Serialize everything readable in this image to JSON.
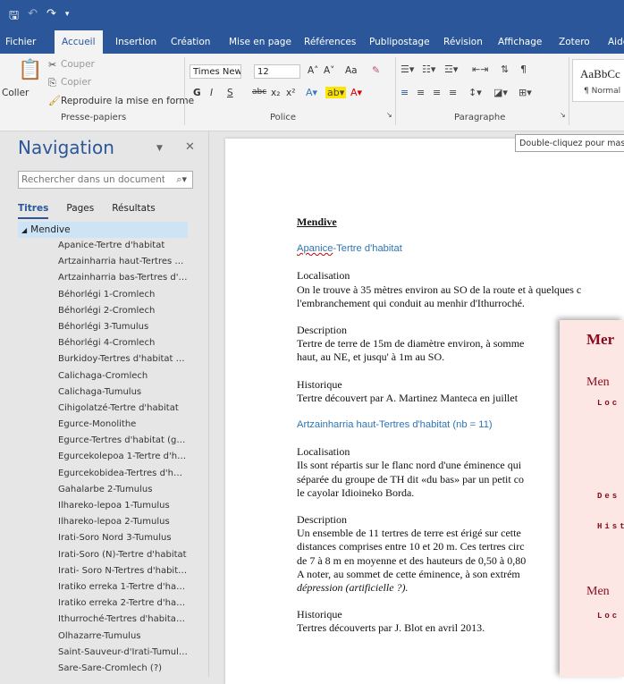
{
  "quick_access": {
    "save_icon": "save-icon",
    "undo_icon": "undo-icon",
    "redo_icon": "redo-icon",
    "customize_icon": "customize-icon"
  },
  "ribbon_tabs": [
    "Fichier",
    "Accueil",
    "Insertion",
    "Création",
    "Mise en page",
    "Références",
    "Publipostage",
    "Révision",
    "Affichage",
    "Zotero",
    "Aide"
  ],
  "clipboard": {
    "couper": "Couper",
    "copier": "Copier",
    "coller": "Coller",
    "reproduire": "Reproduire la mise en forme",
    "label": "Presse-papiers"
  },
  "font": {
    "name": "Times New R",
    "size": "12",
    "bold": "G",
    "italic": "I",
    "underline": "S",
    "strike": "abc",
    "sub": "x₂",
    "sup": "x²",
    "label": "Police",
    "grow": "A˄",
    "shrink": "A˅",
    "case": "Aa"
  },
  "paragraph": {
    "label": "Paragraphe"
  },
  "styles": {
    "sample": "AaBbCc",
    "normal": "¶ Normal"
  },
  "tooltip": "Double-cliquez pour mas",
  "navigation": {
    "title": "Navigation",
    "search_placeholder": "Rechercher dans un document",
    "tabs": [
      "Titres",
      "Pages",
      "Résultats"
    ],
    "root": "Mendive",
    "items": [
      "Apanice-Tertre d'habitat",
      "Artzainharria haut-Tertres d'...",
      "Artzainharria bas-Tertres d'h...",
      "Béhorlégi 1-Cromlech",
      "Béhorlégi 2-Cromlech",
      "Béhorlégi 3-Tumulus",
      "Béhorlégi 4-Cromlech",
      "Burkidoy-Tertres d'habitat (n...",
      "Calichaga-Cromlech",
      "Calichaga-Tumulus",
      "Cihigolatzé-Tertre d'habitat",
      "Egurce-Monolithe",
      "Egurce-Tertres d'habitat (gro...",
      "Egurcekolepoa 1-Tertre d'ha...",
      "Egurcekobidea-Tertres d'hab...",
      "Gahalarbe 2-Tumulus",
      "Ilhareko-lepoa 1-Tumulus",
      "Ilhareko-lepoa 2-Tumulus",
      "Irati-Soro Nord 3-Tumulus",
      "Irati-Soro (N)-Tertre d'habitat",
      "Irati- Soro N-Tertres d'habita...",
      "Iratiko erreka 1-Tertre d'hab...",
      "Iratiko erreka 2-Tertre d'habi...",
      "Ithurroché-Tertres d'habitat...",
      "Olhazarre-Tumulus",
      "Saint-Sauveur-d'Irati-Tumulus",
      "Sare-Sare-Cromlech (?)"
    ]
  },
  "document": {
    "title": "Mendive",
    "sec1_heading": "Apanice-Tertre d'habitat",
    "sec1_loc_label": "Localisation",
    "sec1_loc_1": "On le trouve à 35 mètres environ au SO de la route et à quelques c",
    "sec1_loc_2": "l'embranchement qui conduit au menhir d'Ithurroché.",
    "sec1_desc_label": "Description",
    "sec1_desc_1": "Tertre de terre de 15m de diamètre environ, à somme",
    "sec1_desc_2": "haut, au NE, et jusqu' à 1m au SO.",
    "sec1_hist_label": "Historique",
    "sec1_hist_1": "Tertre découvert par A. Martinez Manteca en juillet",
    "sec2_heading": "Artzainharria haut-Tertres d'habitat (nb = 11)",
    "sec2_loc_label": "Localisation",
    "sec2_loc_1": "Ils sont répartis sur le flanc nord d'une éminence qui",
    "sec2_loc_2": "séparée du groupe de TH dit «du bas» par un petit co",
    "sec2_loc_3": "le cayolar Idioineko Borda.",
    "sec2_desc_label": "Description",
    "sec2_desc_1": "Un ensemble de 11 tertres de terre est érigé sur cette",
    "sec2_desc_2": "distances comprises entre 10 et 20 m. Ces tertres circ",
    "sec2_desc_3": "de 7 à 8 m en moyenne et des hauteurs de 0,50 à 0,80",
    "sec2_desc_4": "A noter, au sommet de cette éminence, à son extrém",
    "sec2_desc_5": "dépression (artificielle ?).",
    "sec2_hist_label": "Historique",
    "sec2_hist_1": "Tertres découverts par J. Blot en avril 2013."
  },
  "overlay_window": {
    "title": "Mer",
    "sub1": "Men",
    "loc1": "Loc",
    "des": "Des",
    "hist": "Hist",
    "sub2": "Men",
    "loc2": "Loc"
  }
}
